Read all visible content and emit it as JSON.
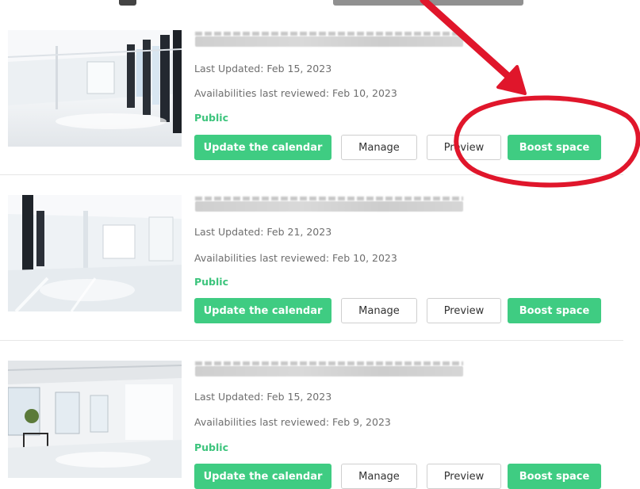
{
  "colors": {
    "accent": "#3fcc82",
    "status": "#3cc47c",
    "annotation": "#e0162b"
  },
  "listings": [
    {
      "address_hidden": true,
      "last_updated": "Last Updated: Feb 15, 2023",
      "availabilities": "Availabilities last reviewed: Feb 10, 2023",
      "status": "Public",
      "buttons": {
        "update": "Update the calendar",
        "manage": "Manage",
        "preview": "Preview",
        "boost": "Boost space"
      }
    },
    {
      "address_hidden": true,
      "last_updated": "Last Updated: Feb 21, 2023",
      "availabilities": "Availabilities last reviewed: Feb 10, 2023",
      "status": "Public",
      "buttons": {
        "update": "Update the calendar",
        "manage": "Manage",
        "preview": "Preview",
        "boost": "Boost space"
      }
    },
    {
      "address_hidden": true,
      "last_updated": "Last Updated: Feb 15, 2023",
      "availabilities": "Availabilities last reviewed: Feb 9, 2023",
      "status": "Public",
      "buttons": {
        "update": "Update the calendar",
        "manage": "Manage",
        "preview": "Preview",
        "boost": "Boost space"
      }
    }
  ],
  "annotation": {
    "shape": "arrow-and-circle",
    "target": "boost-space-button"
  }
}
